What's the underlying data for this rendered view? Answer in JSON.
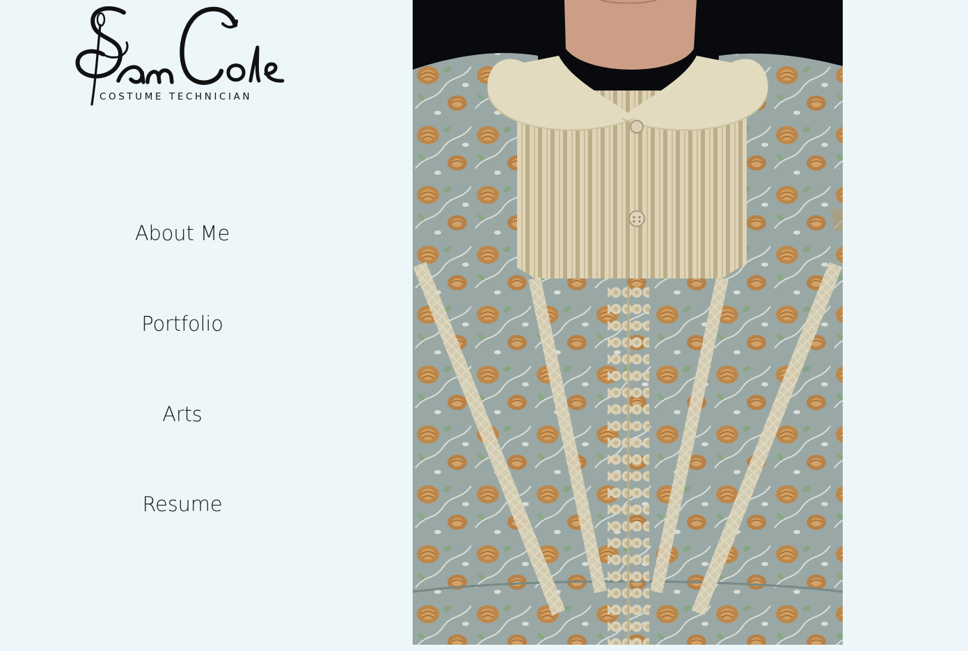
{
  "brand": {
    "logo_text": "SamCole",
    "tagline": "COSTUME TECHNICIAN"
  },
  "nav": {
    "items": [
      {
        "label": "About Me"
      },
      {
        "label": "Portfolio"
      },
      {
        "label": "Arts"
      },
      {
        "label": "Resume"
      }
    ]
  },
  "colors": {
    "page_background": "#edf6f9",
    "text": "#1a1a1a",
    "photo_backdrop": "#0a0b0e",
    "dress_fabric": "#9fb0ad",
    "floral_orange": "#c9904f",
    "lace_cream": "#e9e0c6",
    "collar": "#f1e9cd"
  },
  "hero_image": {
    "subject": "dress-bodice-photo"
  }
}
